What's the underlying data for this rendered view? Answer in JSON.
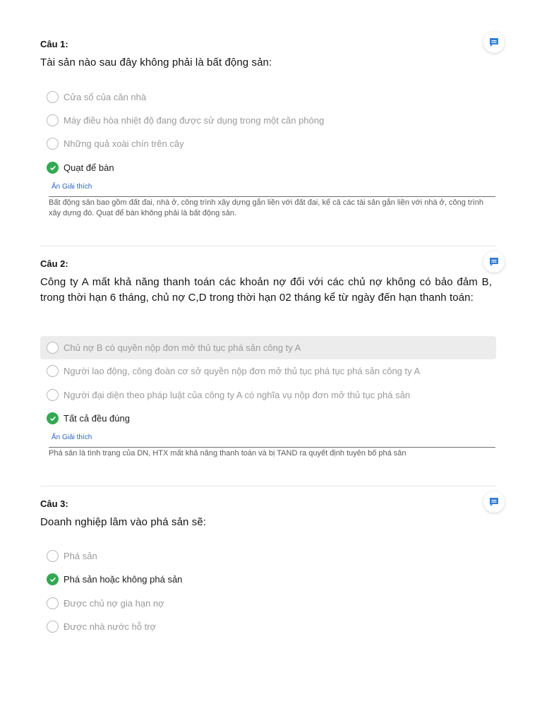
{
  "questions": [
    {
      "label": "Câu 1:",
      "text": "Tài sản nào sau đây không phải là bất động sản:",
      "options": [
        {
          "text": "Cửa sổ của căn nhà"
        },
        {
          "text": "Máy điều hòa nhiệt độ đang được sử dụng trong một căn phòng"
        },
        {
          "text": "Những quả xoài chín trên cây"
        },
        {
          "text": "Quạt để bàn",
          "selected": true
        }
      ],
      "toggle_label": "Ẩn Giải thích",
      "explanation": "Bất động sản bao gồm đất đai, nhà ở, công trình xây dựng gắn liền với đất đai, kể cả các tài sản gắn liền với nhà ở, công trình xây dựng đó. Quạt để bàn không phải là bất động sản."
    },
    {
      "label": "Câu 2:",
      "text": "Công ty A mất khả năng thanh toán các khoản nợ đối với các chủ nợ không có bảo đảm B, trong thời hạn 6 tháng, chủ nợ C,D trong thời hạn 02 tháng kể từ ngày đến hạn thanh toán:",
      "options": [
        {
          "text": "Chủ nợ B có quyền nộp đơn mở thủ tục phá sản công ty A",
          "highlighted": true
        },
        {
          "text": "Người lao động, công đoàn cơ sở quyền nộp đơn mở thủ tục phá tục phá sản công ty A"
        },
        {
          "text": "Người đại diện theo pháp luật của công ty A có nghĩa vụ nộp đơn mở thủ tục phá sản"
        },
        {
          "text": "Tất cả đều đúng",
          "selected": true
        }
      ],
      "toggle_label": "Ẩn Giải thích",
      "explanation": "Phá sản là tình trạng của DN, HTX mất khả năng thanh toán và bị TAND ra quyết định tuyên bố phá sản"
    },
    {
      "label": "Câu 3:",
      "text": "Doanh nghiệp lâm vào phá sản sẽ:",
      "options": [
        {
          "text": "Phá sản"
        },
        {
          "text": "Phá sản hoặc không phá sản",
          "selected": true
        },
        {
          "text": "Được chủ nợ gia hạn nợ"
        },
        {
          "text": "Được nhà nước hỗ trợ"
        }
      ]
    }
  ],
  "colors": {
    "selected": "#34a853",
    "link": "#2a63c6",
    "comment_icon": "#2f7fd8",
    "highlight": "#ececec"
  },
  "icons": {
    "comment": "comment-icon",
    "check": "check-icon"
  }
}
